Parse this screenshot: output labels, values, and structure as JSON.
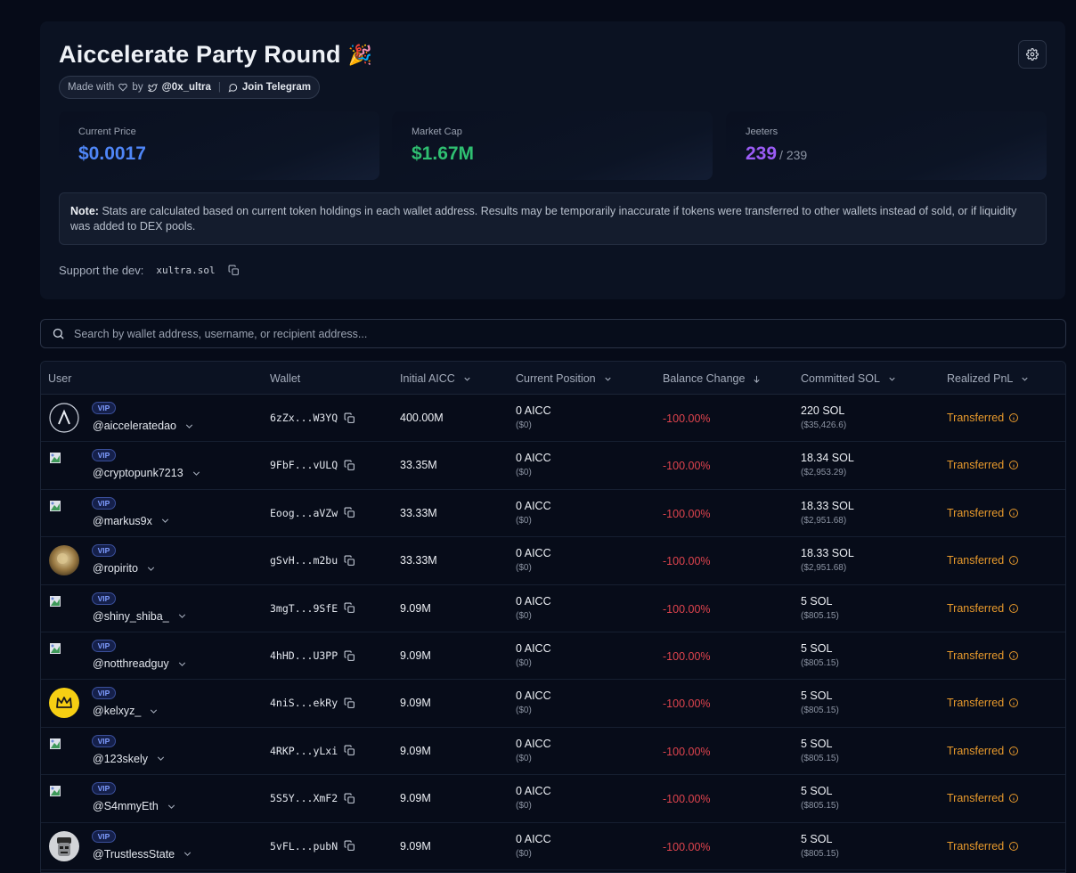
{
  "header": {
    "title": "Aiccelerate Party Round",
    "title_emoji": "🎉",
    "credit": {
      "made_with": "Made with",
      "by": "by",
      "handle": "@0x_ultra",
      "telegram": "Join Telegram"
    }
  },
  "stats": {
    "price": {
      "label": "Current Price",
      "value": "$0.0017",
      "color": "#4f86f7"
    },
    "market_cap": {
      "label": "Market Cap",
      "value": "$1.67M",
      "color": "#2fbf71"
    },
    "jeeters": {
      "label": "Jeeters",
      "value": "239",
      "total": "/ 239",
      "color": "#9b5cf6"
    }
  },
  "note": {
    "label": "Note:",
    "text": "Stats are calculated based on current token holdings in each wallet address. Results may be temporarily inaccurate if tokens were transferred to other wallets instead of sold, or if liquidity was added to DEX pools."
  },
  "support": {
    "label": "Support the dev:",
    "address": "xultra.sol"
  },
  "search": {
    "placeholder": "Search by wallet address, username, or recipient address..."
  },
  "table": {
    "columns": [
      "User",
      "Wallet",
      "Initial AICC",
      "Current Position",
      "Balance Change",
      "Committed SOL",
      "Realized PnL"
    ],
    "vip_label": "VIP",
    "rows": [
      {
        "avatar": "logo",
        "user": "@aiccelerate­dao",
        "wallet": "6zZx...W3YQ",
        "initial": "400.00M",
        "position": "0 AICC",
        "position_usd": "($0)",
        "change": "-100.00%",
        "sol": "220 SOL",
        "sol_usd": "($35,426.6)",
        "pnl": "Transferred"
      },
      {
        "avatar": "broken",
        "user": "@cryptopunk7213",
        "wallet": "9FbF...vULQ",
        "initial": "33.35M",
        "position": "0 AICC",
        "position_usd": "($0)",
        "change": "-100.00%",
        "sol": "18.34 SOL",
        "sol_usd": "($2,953.29)",
        "pnl": "Transferred"
      },
      {
        "avatar": "broken",
        "user": "@markus9x",
        "wallet": "Eoog...aVZw",
        "initial": "33.33M",
        "position": "0 AICC",
        "position_usd": "($0)",
        "change": "-100.00%",
        "sol": "18.33 SOL",
        "sol_usd": "($2,951.68)",
        "pnl": "Transferred"
      },
      {
        "avatar": "photo",
        "user": "@ropirito",
        "wallet": "gSvH...m2bu",
        "initial": "33.33M",
        "position": "0 AICC",
        "position_usd": "($0)",
        "change": "-100.00%",
        "sol": "18.33 SOL",
        "sol_usd": "($2,951.68)",
        "pnl": "Transferred"
      },
      {
        "avatar": "broken",
        "user": "@shiny_shiba_",
        "wallet": "3mgT...9SfE",
        "initial": "9.09M",
        "position": "0 AICC",
        "position_usd": "($0)",
        "change": "-100.00%",
        "sol": "5 SOL",
        "sol_usd": "($805.15)",
        "pnl": "Transferred"
      },
      {
        "avatar": "broken",
        "user": "@notthreadguy",
        "wallet": "4hHD...U3PP",
        "initial": "9.09M",
        "position": "0 AICC",
        "position_usd": "($0)",
        "change": "-100.00%",
        "sol": "5 SOL",
        "sol_usd": "($805.15)",
        "pnl": "Transferred"
      },
      {
        "avatar": "crown",
        "user": "@kelxyz_",
        "wallet": "4niS...ekRy",
        "initial": "9.09M",
        "position": "0 AICC",
        "position_usd": "($0)",
        "change": "-100.00%",
        "sol": "5 SOL",
        "sol_usd": "($805.15)",
        "pnl": "Transferred"
      },
      {
        "avatar": "broken",
        "user": "@123skely",
        "wallet": "4RKP...yLxi",
        "initial": "9.09M",
        "position": "0 AICC",
        "position_usd": "($0)",
        "change": "-100.00%",
        "sol": "5 SOL",
        "sol_usd": "($805.15)",
        "pnl": "Transferred"
      },
      {
        "avatar": "broken",
        "user": "@S4mmyEth",
        "wallet": "5S5Y...XmF2",
        "initial": "9.09M",
        "position": "0 AICC",
        "position_usd": "($0)",
        "change": "-100.00%",
        "sol": "5 SOL",
        "sol_usd": "($805.15)",
        "pnl": "Transferred"
      },
      {
        "avatar": "mask",
        "user": "@TrustlessState",
        "wallet": "5vFL...pubN",
        "initial": "9.09M",
        "position": "0 AICC",
        "position_usd": "($0)",
        "change": "-100.00%",
        "sol": "5 SOL",
        "sol_usd": "($805.15)",
        "pnl": "Transferred"
      }
    ]
  }
}
